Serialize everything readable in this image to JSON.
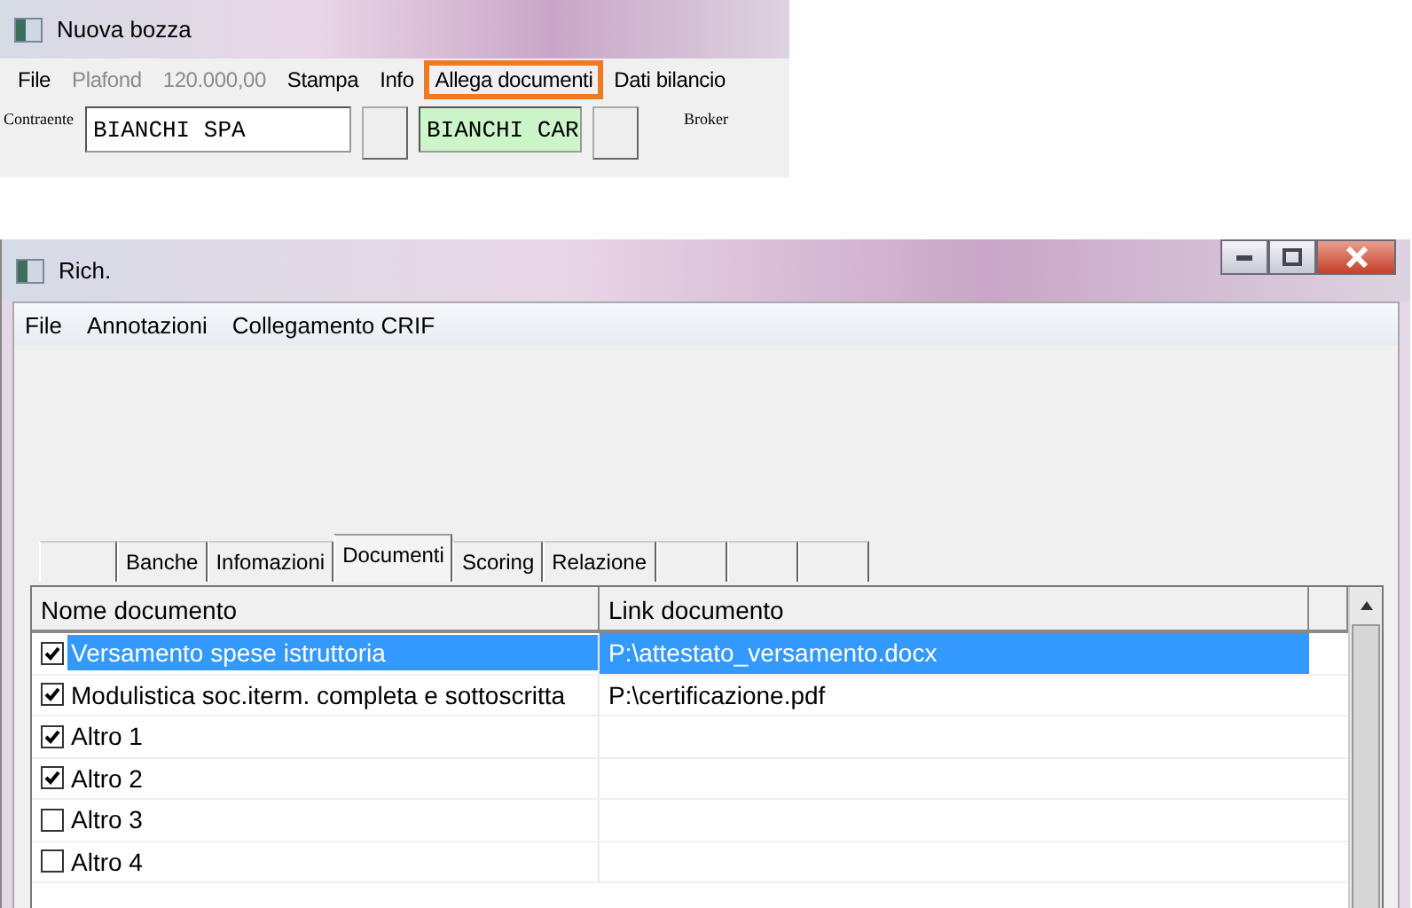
{
  "top_window": {
    "title": "Nuova bozza",
    "menu": [
      {
        "label": "File",
        "disabled": false,
        "selected": false
      },
      {
        "label": "Plafond",
        "disabled": true,
        "selected": false
      },
      {
        "label": "120.000,00",
        "disabled": true,
        "selected": false
      },
      {
        "label": "Stampa",
        "disabled": false,
        "selected": false
      },
      {
        "label": "Info",
        "disabled": false,
        "selected": false
      },
      {
        "label": "Allega documenti",
        "disabled": false,
        "selected": true
      },
      {
        "label": "Dati bilancio",
        "disabled": false,
        "selected": false
      }
    ],
    "contraente_label": "Contraente",
    "contraente_value": "BIANCHI SPA",
    "second_value": "BIANCHI CAR",
    "broker_label": "Broker"
  },
  "window": {
    "title": "Rich.",
    "menu": [
      "File",
      "Annotazioni",
      "Collegamento CRIF"
    ],
    "tabs": [
      {
        "selected": false
      },
      {
        "label": "Banche",
        "selected": false
      },
      {
        "label": "Infomazioni",
        "selected": false
      },
      {
        "label": "Documenti",
        "selected": true
      },
      {
        "label": "Scoring",
        "selected": false
      },
      {
        "label": "Relazione",
        "selected": false
      },
      {
        "selected": false
      },
      {
        "selected": false
      },
      {
        "selected": false
      }
    ],
    "table": {
      "columns": [
        "Nome documento",
        "Link documento"
      ],
      "rows": [
        {
          "name": "Versamento spese istruttoria",
          "link": "P:\\attestato_versamento.docx",
          "checked": true,
          "selected": true
        },
        {
          "name": "Modulistica soc.iterm. completa e sottoscritta",
          "link": "P:\\certificazione.pdf",
          "checked": true,
          "selected": false
        },
        {
          "name": "Altro 1",
          "checked": true,
          "selected": false
        },
        {
          "name": "Altro 2",
          "checked": true,
          "selected": false
        },
        {
          "name": "Altro 3",
          "checked": false,
          "selected": false
        },
        {
          "name": "Altro 4",
          "checked": false,
          "selected": false
        }
      ]
    }
  }
}
